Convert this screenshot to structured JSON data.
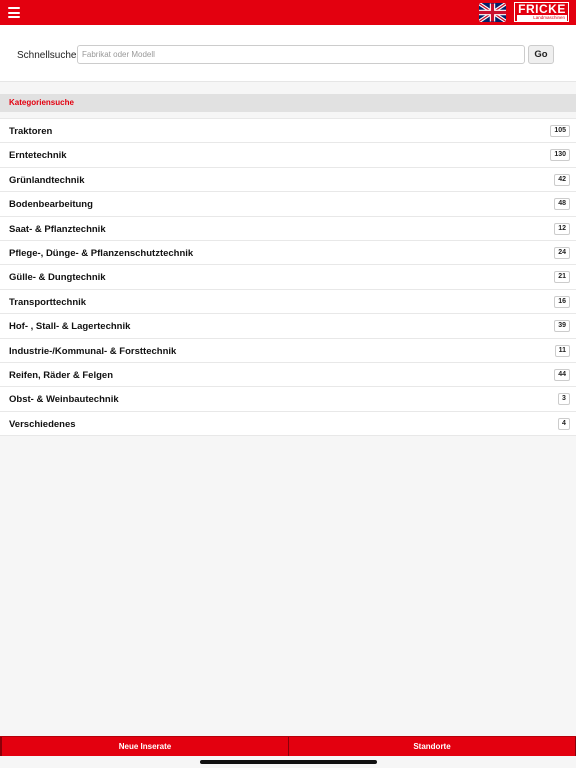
{
  "header": {
    "menu_icon": "hamburger-menu-icon",
    "flag_icon": "uk-flag-icon",
    "logo": {
      "main": "FRICKE",
      "sub": "Landmaschinen"
    },
    "brand_color": "#e3000f"
  },
  "search": {
    "label": "Schnellsuche:",
    "placeholder": "Fabrikat oder Modell",
    "value": "",
    "button_label": "Go"
  },
  "categories": {
    "title": "Kategoriensuche",
    "items": [
      {
        "label": "Traktoren",
        "count": "105"
      },
      {
        "label": "Erntetechnik",
        "count": "130"
      },
      {
        "label": "Grünlandtechnik",
        "count": "42"
      },
      {
        "label": "Bodenbearbeitung",
        "count": "48"
      },
      {
        "label": "Saat- & Pflanztechnik",
        "count": "12"
      },
      {
        "label": "Pflege-, Dünge- & Pflanzenschutztechnik",
        "count": "24"
      },
      {
        "label": "Gülle- & Dungtechnik",
        "count": "21"
      },
      {
        "label": "Transporttechnik",
        "count": "16"
      },
      {
        "label": "Hof- , Stall- & Lagertechnik",
        "count": "39"
      },
      {
        "label": "Industrie-/Kommunal- & Forsttechnik",
        "count": "11"
      },
      {
        "label": "Reifen, Räder & Felgen",
        "count": "44"
      },
      {
        "label": "Obst- & Weinbautechnik",
        "count": "3"
      },
      {
        "label": "Verschiedenes",
        "count": "4"
      }
    ]
  },
  "bottom_nav": {
    "left_label": "Neue Inserate",
    "right_label": "Standorte"
  }
}
